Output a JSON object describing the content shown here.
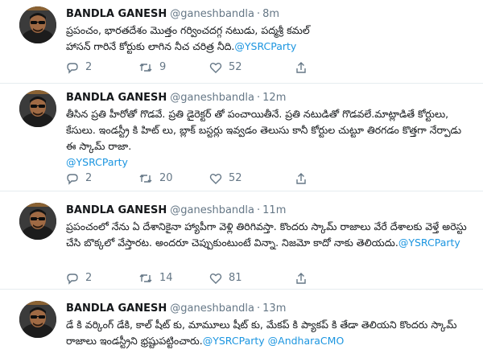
{
  "tweets": [
    {
      "name": "BANDLA GANESH",
      "handle": "@ganeshbandla",
      "separator": "·",
      "time": "8m",
      "text": "ప్రపంచం, భారతదేశం మొత్తం గర్వించదగ్గ నటుడు, పద్మశ్రీ కమల్ హాసన్ గారినే కోర్టుకు లాగిన నీచ చరిత్ర నీది.",
      "mentions": "@YSRCParty",
      "actions": {
        "replies": "2",
        "retweets": "9",
        "likes": "52"
      }
    },
    {
      "name": "BANDLA GANESH",
      "handle": "@ganeshbandla",
      "separator": "·",
      "time": "12m",
      "text": "తీసిన ప్రతి హీరోతో గొడవే. ప్రతి డైరెక్టర్ తో పంచాయితీనే. ప్రతి నటుడితో గొడవలే.మాట్లాడితే కోర్టులు, కేసులు. ఇండస్ట్రీ కి హిట్ లు, బ్లాక్ బస్టర్లు ఇవ్వడం తెలుసు కానీ కోర్టుల చుట్టూ తిరగడం కొత్తగా నేర్పాడు ఈ స్కామ్ రాజా.",
      "mentions": "@YSRCParty",
      "actions": {
        "replies": "2",
        "retweets": "20",
        "likes": "52"
      }
    },
    {
      "name": "BANDLA GANESH",
      "handle": "@ganeshbandla",
      "separator": "·",
      "time": "11m",
      "text": "ప్రపంచంలో నేను ఏ దేశానికైనా హ్యాపీగా వెళ్లి తిరిగివస్తా. కొందరు స్కామ్ రాజాలు వేరే దేశాలకు వెళ్తే అరెస్టు చేసి బొక్కలో వేస్తారట. అందరూ చెప్పుకుంటుంటే విన్నా. నిజమో కాదో నాకు తెలియదు.",
      "mentions": "@YSRCParty",
      "actions": {
        "replies": "2",
        "retweets": "14",
        "likes": "81"
      }
    },
    {
      "name": "BANDLA GANESH",
      "handle": "@ganeshbandla",
      "separator": "·",
      "time": "13m",
      "text": "డే కి వర్కింగ్ డేకి, కాల్ షీట్ కు, మామూలు షీట్ కు, మేకప్ కి ప్యాకప్ కి తేడా తెలియని కొందరు స్కామ్ రాజాలు ఇండస్ట్రీని భ్రష్టుపట్టించారు.",
      "mentions": "@YSRCParty @AndharaCMO",
      "actions": {
        "replies": "",
        "retweets": "",
        "likes": ""
      }
    }
  ],
  "colors": {
    "text": "#14171a",
    "muted": "#657786",
    "link": "#1b95e0",
    "divider": "#e6ecf0"
  },
  "icons": [
    "avatar",
    "reply-icon",
    "retweet-icon",
    "like-icon",
    "share-icon"
  ]
}
